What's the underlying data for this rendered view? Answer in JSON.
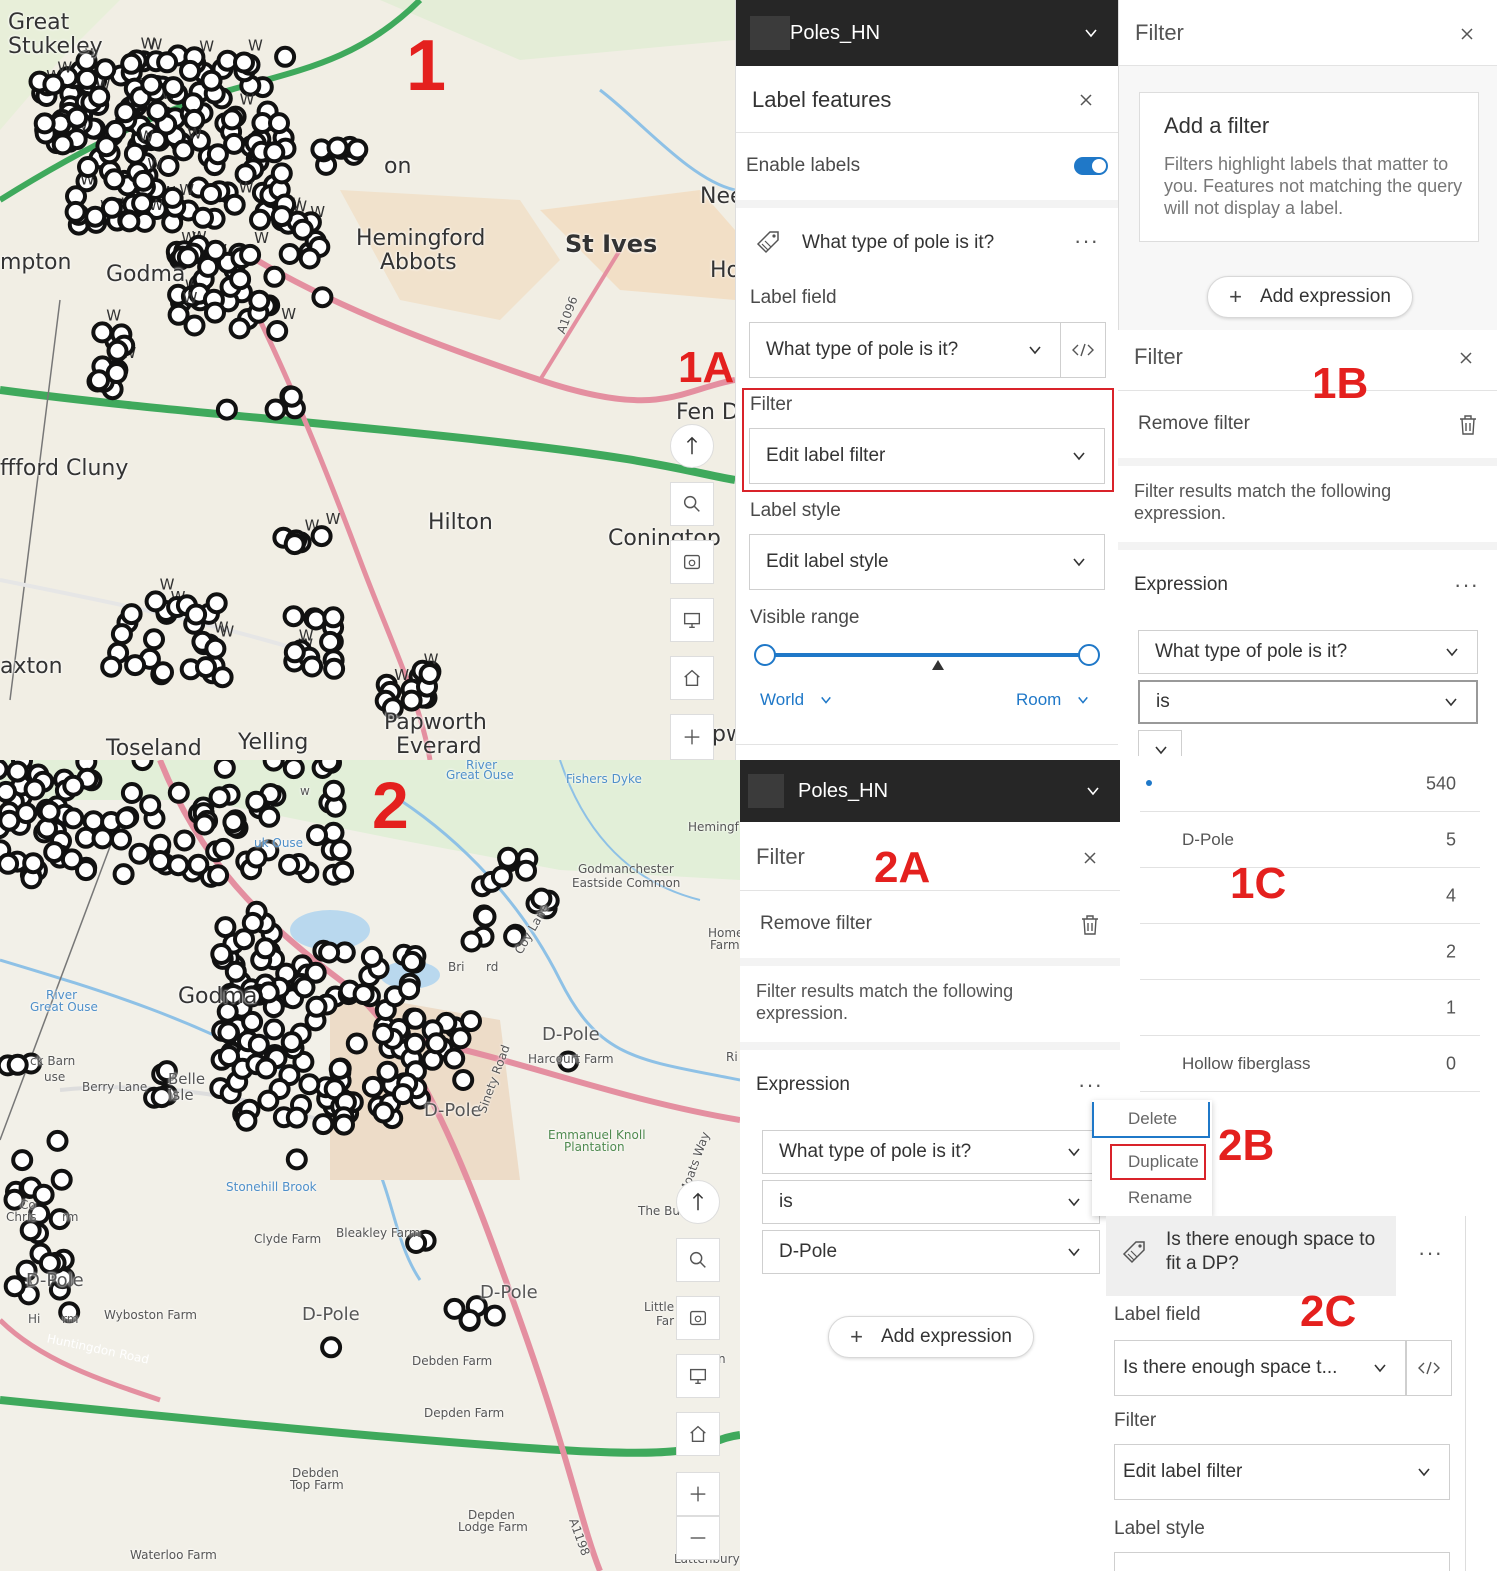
{
  "colors": {
    "header_dark": "#262626",
    "toggle_blue": "#1f78c8",
    "annotation_red": "#e4201e",
    "road_pink": "#e48fa0",
    "road_green": "#3fa95c",
    "slider_blue": "#1f78c8"
  },
  "annotations": [
    "1",
    "1A",
    "1B",
    "1C",
    "2",
    "2A",
    "2B",
    "2C"
  ],
  "map1": {
    "places": [
      "Great",
      "Stukeley",
      "Hemingford",
      "Abbots",
      "St Ives",
      "Godma",
      "mpton",
      "Nee",
      "Ho",
      "Fen D",
      "ffford Cluny",
      "Hilton",
      "Coningtop",
      "axton",
      "Toseland",
      "Yelling",
      "Papworth",
      "Everard",
      "on",
      "A1096",
      "pw"
    ],
    "w_label": "W"
  },
  "map2": {
    "places": [
      "Godma",
      "Hemingf",
      "Godmanchester",
      "Eastside Common",
      "Home",
      "Farm",
      "D-Pole",
      "D-Pole",
      "D-Pole",
      "D-Pole",
      "D-Pole",
      "Harcourt Farm",
      "River",
      "Great Ouse",
      "River",
      "Great Ouse",
      "Fishers Dyke",
      "Berry Lane",
      "Belle",
      "Isle",
      "Emmanuel Knoll",
      "Plantation",
      "Stonehill Brook",
      "Clyde Farm",
      "Bleakley Farm",
      "The Bu",
      "Wyboston Farm",
      "Huntingdon Road",
      "Debden Farm",
      "Depden Farm",
      "Debden",
      "Top Farm",
      "Depden",
      "Lodge Farm",
      "Waterloo Farm",
      "Little",
      "Far",
      "Chris",
      "rm",
      "Co",
      "Hi",
      "rm",
      "ck Barn",
      "use",
      "Ri",
      "Lattenbury",
      "Moats Way",
      "Coy Lane",
      "Bri",
      "rd",
      "Sinety Road",
      "A1198",
      "n",
      "uk Ouse",
      "w"
    ]
  },
  "panel1A": {
    "layer_name": "Poles_HN",
    "title": "Label features",
    "enable_labels": "Enable labels",
    "class_name": "What type of pole is it?",
    "label_field_heading": "Label field",
    "label_field_value": "What type of pole is it?",
    "filter_heading": "Filter",
    "filter_value": "Edit label filter",
    "label_style_heading": "Label style",
    "label_style_value": "Edit label style",
    "visible_range_heading": "Visible range",
    "range_min": "World",
    "range_max": "Room"
  },
  "panel1B_top": {
    "title": "Filter",
    "card_title": "Add a filter",
    "card_text": "Filters highlight labels that matter to you. Features not matching the query will not display a label.",
    "add_expression": "Add expression"
  },
  "panel1B": {
    "title": "Filter",
    "remove_filter": "Remove filter",
    "match_text": "Filter results match the following expression.",
    "expression_heading": "Expression",
    "field_value": "What type of pole is it?",
    "operator_value": "is"
  },
  "panel1C": {
    "rows": [
      {
        "label": "",
        "count": "540"
      },
      {
        "label": "D-Pole",
        "count": "5"
      },
      {
        "label": "",
        "count": "4"
      },
      {
        "label": "",
        "count": "2"
      },
      {
        "label": "",
        "count": "1"
      },
      {
        "label": "Hollow fiberglass",
        "count": "0"
      }
    ]
  },
  "panel2A": {
    "layer_name": "Poles_HN",
    "title": "Filter",
    "remove_filter": "Remove filter",
    "match_text": "Filter results match the following expression.",
    "expression_heading": "Expression",
    "field_value": "What type of pole is it?",
    "operator_value": "is",
    "value_value": "D-Pole",
    "add_expression": "Add expression"
  },
  "menu2B": {
    "items": [
      "Delete",
      "Duplicate",
      "Rename"
    ]
  },
  "panel2C": {
    "class_name": "Is there enough space to fit a DP?",
    "label_field_heading": "Label field",
    "label_field_value": "Is there enough space t...",
    "filter_heading": "Filter",
    "filter_value": "Edit label filter",
    "label_style_heading": "Label style"
  },
  "icons": [
    "chevron-down-icon",
    "close-icon",
    "toggle-switch",
    "label-tag-icon",
    "more-dots-icon",
    "code-icon",
    "trash-icon",
    "plus-icon",
    "search-icon",
    "basemap-icon",
    "screen-icon",
    "home-icon",
    "compass-arrow-icon",
    "zoom-in-icon",
    "zoom-out-icon"
  ]
}
